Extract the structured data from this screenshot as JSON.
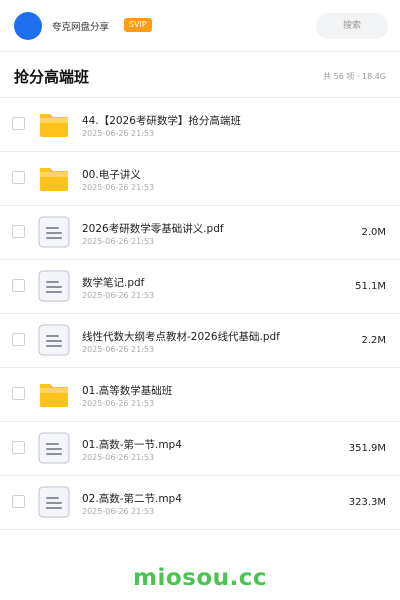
{
  "header": {
    "user_name": "夸克网盘分享",
    "badge": "SVIP",
    "search_label": "搜索",
    "avatar_color": "#1e6ff0"
  },
  "folder": {
    "title": "抢分高端班",
    "meta": "共 56 项 · 18.4G"
  },
  "files": [
    {
      "name": "44.【2026考研数学】抢分高端班",
      "date": "2025-06-26 21:53",
      "size": "",
      "type": "folder"
    },
    {
      "name": "00.电子讲义",
      "date": "2025-06-26 21:53",
      "size": "",
      "type": "folder"
    },
    {
      "name": "2026考研数学零基础讲义.pdf",
      "date": "2025-06-26 21:53",
      "size": "2.0M",
      "type": "document"
    },
    {
      "name": "数学笔记.pdf",
      "date": "2025-06-26 21:53",
      "size": "51.1M",
      "type": "document"
    },
    {
      "name": "线性代数大纲考点教材-2026线代基础.pdf",
      "date": "2025-06-26 21:53",
      "size": "2.2M",
      "type": "document"
    },
    {
      "name": "01.高等数学基础班",
      "date": "2025-06-26 21:53",
      "size": "",
      "type": "folder"
    },
    {
      "name": "01.高数-第一节.mp4",
      "date": "2025-06-26 21:53",
      "size": "351.9M",
      "type": "document"
    },
    {
      "name": "02.高数-第二节.mp4",
      "date": "2025-06-26 21:53",
      "size": "323.3M",
      "type": "document"
    }
  ],
  "icons": {
    "folder": "folder-icon",
    "document": "document-icon"
  },
  "footer": {
    "watermark": "miosou.cc",
    "watermark_color": "#4cc454"
  }
}
